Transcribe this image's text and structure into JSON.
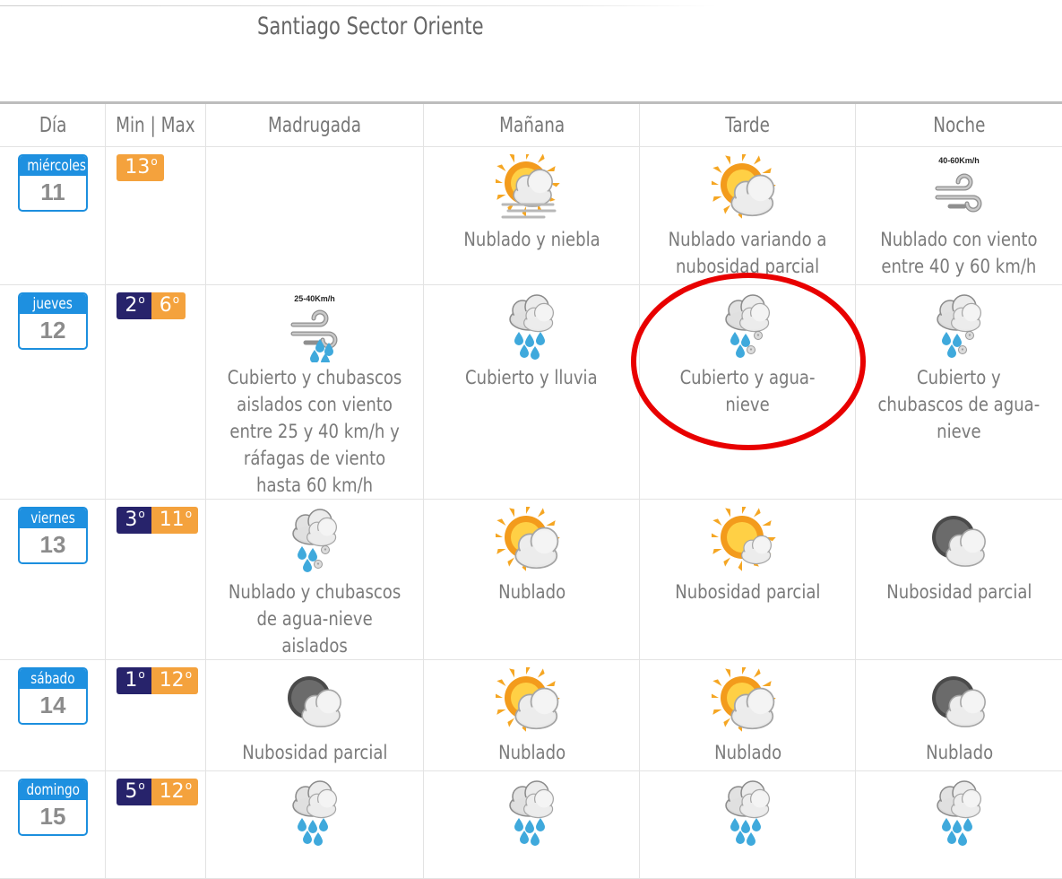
{
  "header": {
    "title": "Santiago Sector Oriente"
  },
  "columns": [
    "Día",
    "Min | Max",
    "Madrugada",
    "Mañana",
    "Tarde",
    "Noche"
  ],
  "rows": [
    {
      "day": "miércoles",
      "date": "11",
      "min": "",
      "max": "13",
      "periods": [
        {
          "icon": "",
          "desc": ""
        },
        {
          "icon": "sun-cloud-fog-icon",
          "desc": "Nublado y niebla"
        },
        {
          "icon": "sun-cloud-icon",
          "desc": "Nublado variando a nubosidad parcial"
        },
        {
          "icon": "wind-icon",
          "desc": "Nublado con viento entre 40 y 60 km/h",
          "wind_label": "40-60Km/h"
        }
      ]
    },
    {
      "day": "jueves",
      "date": "12",
      "min": "2",
      "max": "6",
      "periods": [
        {
          "icon": "wind-rain-icon",
          "desc": "Cubierto y chubascos aislados con viento entre 25 y 40 km/h y ráfagas de viento hasta 60 km/h",
          "wind_label": "25-40Km/h"
        },
        {
          "icon": "rain-icon",
          "desc": "Cubierto y lluvia"
        },
        {
          "icon": "sleet-icon",
          "desc": "Cubierto y agua-nieve"
        },
        {
          "icon": "sleet-icon",
          "desc": "Cubierto y chubascos de agua-nieve"
        }
      ]
    },
    {
      "day": "viernes",
      "date": "13",
      "min": "3",
      "max": "11",
      "periods": [
        {
          "icon": "sleet-icon",
          "desc": "Nublado y chubascos de agua-nieve aislados"
        },
        {
          "icon": "sun-cloud-icon",
          "desc": "Nublado"
        },
        {
          "icon": "sun-small-cloud-icon",
          "desc": "Nubosidad parcial"
        },
        {
          "icon": "moon-cloud-icon",
          "desc": "Nubosidad parcial"
        }
      ]
    },
    {
      "day": "sábado",
      "date": "14",
      "min": "1",
      "max": "12",
      "periods": [
        {
          "icon": "moon-cloud-icon",
          "desc": "Nubosidad parcial"
        },
        {
          "icon": "sun-cloud-icon",
          "desc": "Nublado"
        },
        {
          "icon": "sun-cloud-icon",
          "desc": "Nublado"
        },
        {
          "icon": "moon-cloud-icon",
          "desc": "Nublado"
        }
      ]
    },
    {
      "day": "domingo",
      "date": "15",
      "min": "5",
      "max": "12",
      "periods": [
        {
          "icon": "rain-icon",
          "desc": ""
        },
        {
          "icon": "rain-icon",
          "desc": ""
        },
        {
          "icon": "rain-icon",
          "desc": ""
        },
        {
          "icon": "rain-icon",
          "desc": ""
        }
      ]
    }
  ],
  "colors": {
    "calendar_blue": "#1e90e0",
    "min_temp": "#27236b",
    "max_temp": "#f4a23d",
    "highlight": "#e80000"
  }
}
